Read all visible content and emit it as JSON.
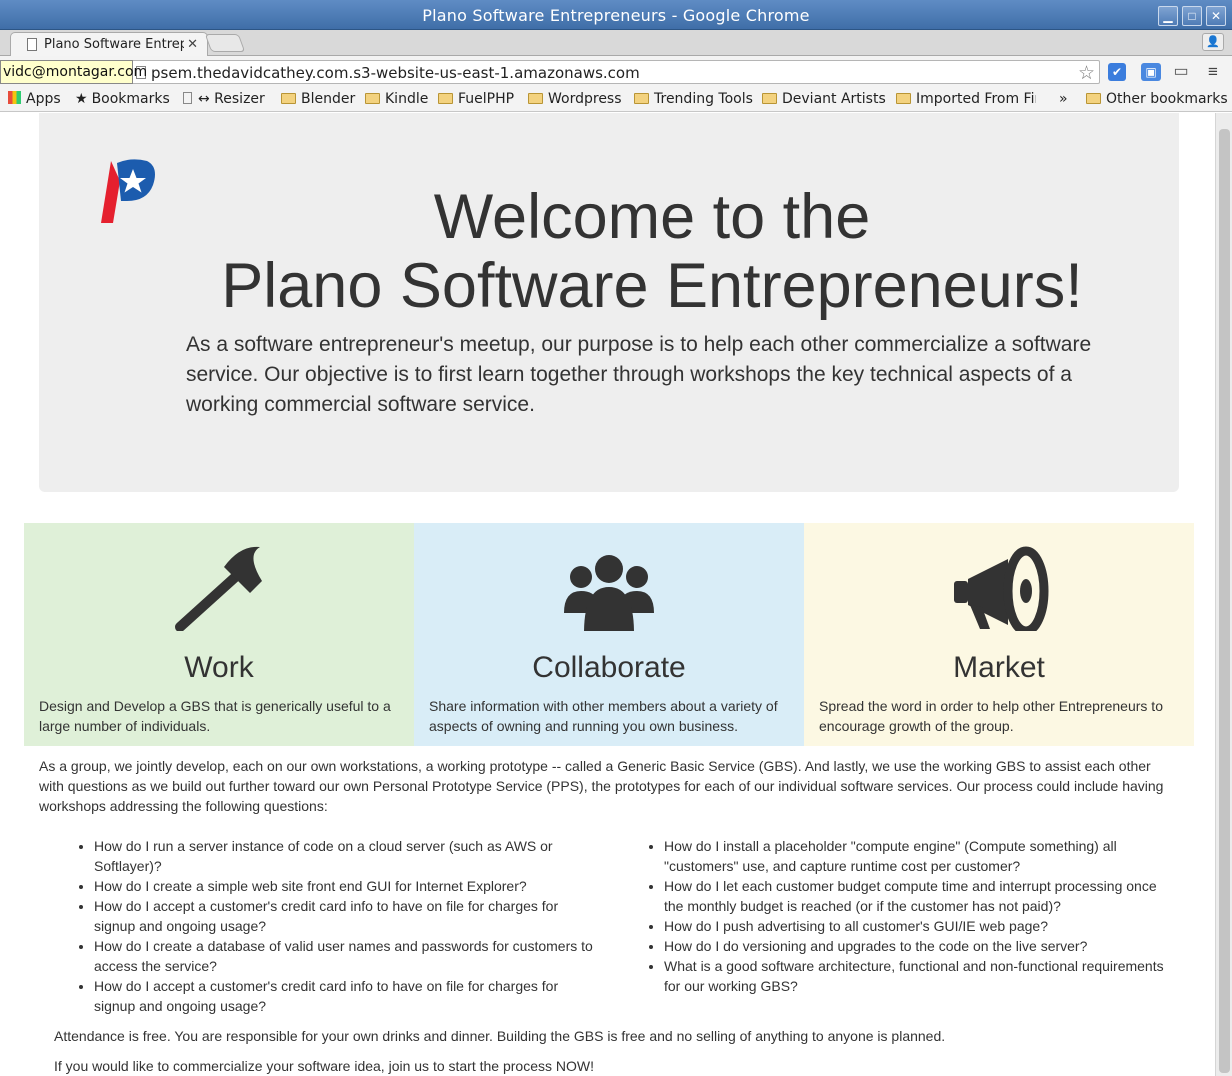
{
  "window": {
    "title": "Plano Software Entrepreneurs - Google Chrome"
  },
  "tabs": [
    {
      "label": "Plano Software Entrepreneurs"
    }
  ],
  "toolbar": {
    "url": "psem.thedavidcathey.com.s3-website-us-east-1.amazonaws.com",
    "tooltip": "vidc@montagar.com"
  },
  "bookmarks": {
    "apps": "Apps",
    "bookmarks": "Bookmarks",
    "resizer": "↔ Resizer",
    "items": [
      "Blender",
      "Kindle",
      "FuelPHP",
      "Wordpress",
      "Trending Tools",
      "Deviant Artists",
      "Imported From Fir"
    ],
    "overflow": "»",
    "other": "Other bookmarks"
  },
  "hero": {
    "title_line1": "Welcome to the",
    "title_line2": "Plano Software Entrepreneurs!",
    "text": "As a software entrepreneur's meetup, our purpose is to help each other commercialize a software service. Our objective is to first learn together through workshops the key technical aspects of a working commercial software service."
  },
  "panels": [
    {
      "icon": "hammer-icon",
      "title": "Work",
      "text": "Design and Develop a GBS that is generically useful to a large number of individuals.",
      "color": "#dff0d8"
    },
    {
      "icon": "users-icon",
      "title": "Collaborate",
      "text": "Share information with other members about a variety of aspects of owning and running you own business.",
      "color": "#d9edf7"
    },
    {
      "icon": "bullhorn-icon",
      "title": "Market",
      "text": "Spread the word in order to help other Entrepreneurs to encourage growth of the group.",
      "color": "#fcf8e3"
    }
  ],
  "intro": "As a group, we jointly develop, each on our own workstations, a working prototype -- called a Generic Basic Service (GBS). And lastly, we use the working GBS to assist each other with questions as we build out further toward our own Personal Prototype Service (PPS), the prototypes for each of our individual software services. Our process could include having workshops addressing the following questions:",
  "questions_left": [
    "How do I run a server instance of code on a cloud server (such as AWS or Softlayer)?",
    "How do I create a simple web site front end GUI for Internet Explorer?",
    "How do I accept a customer's credit card info to have on file for charges for signup and ongoing usage?",
    "How do I create a database of valid user names and passwords for customers to access the service?",
    "How do I accept a customer's credit card info to have on file for charges for signup and ongoing usage?"
  ],
  "questions_right": [
    "How do I install a placeholder \"compute engine\" (Compute something) all \"customers\" use, and capture runtime cost per customer?",
    "How do I let each customer budget compute time and interrupt processing once the monthly budget is reached (or if the customer has not paid)?",
    "How do I push advertising to all customer's GUI/IE web page?",
    "How do I do versioning and upgrades to the code on the live server?",
    "What is a good software architecture, functional and non-functional requirements for our working GBS?"
  ],
  "attendance": "Attendance is free. You are responsible for your own drinks and dinner. Building the GBS is free and no selling of anything to anyone is planned.",
  "cta": "If you would like to commercialize your software idea, join us to start the process NOW!"
}
